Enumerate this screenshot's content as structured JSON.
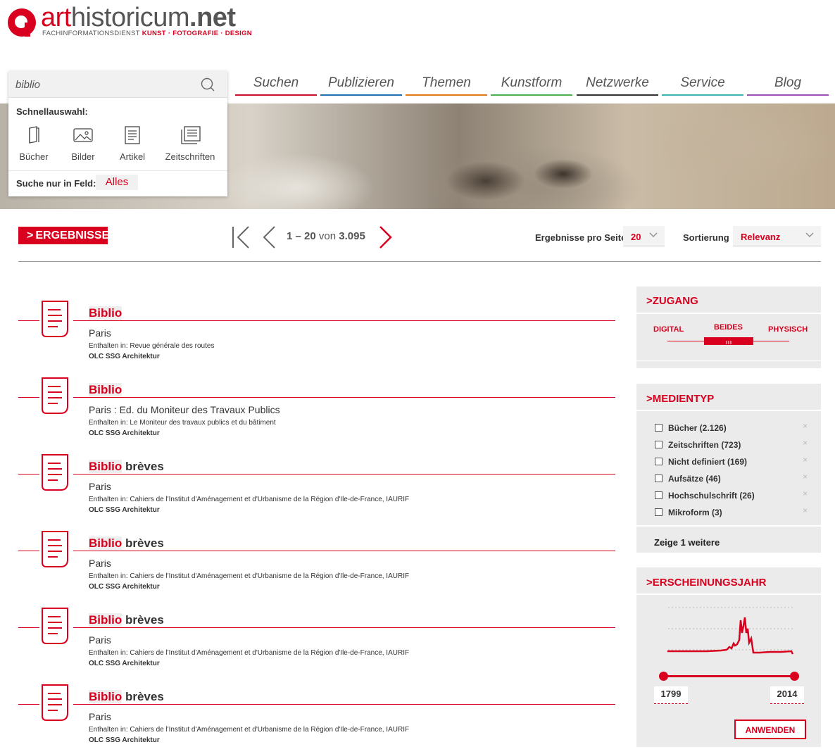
{
  "brand": {
    "name_prefix": "art",
    "name_main": "historicum",
    "name_suffix": ".net",
    "tagline_plain": "FACHINFORMATIONSDIENST",
    "tagline_accent": "KUNST · FOTOGRAFIE · DESIGN",
    "accent_color": "#d8001e"
  },
  "search": {
    "query": "biblio",
    "quick_label": "Schnellauswahl:",
    "quick_items": [
      "Bücher",
      "Bilder",
      "Artikel",
      "Zeitschriften"
    ],
    "field_label": "Suche nur in Feld:",
    "field_value": "Alles"
  },
  "nav": {
    "items": [
      {
        "label": "Suchen",
        "color": "#c8102e"
      },
      {
        "label": "Publizieren",
        "color": "#1f6fb2"
      },
      {
        "label": "Themen",
        "color": "#e07b1a"
      },
      {
        "label": "Kunstform",
        "color": "#4caf50"
      },
      {
        "label": "Netzwerke",
        "color": "#333333"
      },
      {
        "label": "Service",
        "color": "#3fb3b0"
      },
      {
        "label": "Blog",
        "color": "#9c4fb5"
      }
    ]
  },
  "toolbar": {
    "results_label": "ERGEBNISSE",
    "range": "1 – 20",
    "of_word": "von",
    "total": "3.095",
    "per_page_label": "Ergebnisse pro Seite",
    "per_page_value": "20",
    "sort_label": "Sortierung",
    "sort_value": "Relevanz"
  },
  "results": [
    {
      "title_hl": "Biblio",
      "title_rest": "",
      "subtitle": "Paris",
      "contained_in": "Enthalten in: Revue générale des routes",
      "source": "OLC SSG Architektur"
    },
    {
      "title_hl": "Biblio",
      "title_rest": "",
      "subtitle": "Paris : Ed. du Moniteur des Travaux Publics",
      "contained_in": "Enthalten in: Le Moniteur des travaux publics et du bâtiment",
      "source": "OLC SSG Architektur"
    },
    {
      "title_hl": "Biblio",
      "title_rest": "brèves",
      "subtitle": "Paris",
      "contained_in": "Enthalten in: Cahiers de l'Institut d'Aménagement et d'Urbanisme de la Région d'Ile-de-France, IAURIF",
      "source": "OLC SSG Architektur"
    },
    {
      "title_hl": "Biblio",
      "title_rest": "brèves",
      "subtitle": "Paris",
      "contained_in": "Enthalten in: Cahiers de l'Institut d'Aménagement et d'Urbanisme de la Région d'Ile-de-France, IAURIF",
      "source": "OLC SSG Architektur"
    },
    {
      "title_hl": "Biblio",
      "title_rest": "brèves",
      "subtitle": "Paris",
      "contained_in": "Enthalten in: Cahiers de l'Institut d'Aménagement et d'Urbanisme de la Région d'Ile-de-France, IAURIF",
      "source": "OLC SSG Architektur"
    },
    {
      "title_hl": "Biblio",
      "title_rest": "brèves",
      "subtitle": "Paris",
      "contained_in": "Enthalten in: Cahiers de l'Institut d'Aménagement et d'Urbanisme de la Région d'Ile-de-France, IAURIF",
      "source": "OLC SSG Architektur"
    }
  ],
  "facets": {
    "zugang": {
      "title": "ZUGANG",
      "options": [
        "DIGITAL",
        "BEIDES",
        "PHYSISCH"
      ],
      "selected": "BEIDES"
    },
    "medientyp": {
      "title": "MEDIENTYP",
      "items": [
        "Bücher (2.126)",
        "Zeitschriften (723)",
        "Nicht definiert (169)",
        "Aufsätze (46)",
        "Hochschulschrift (26)",
        "Mikroform (3)"
      ],
      "more": "Zeige 1 weitere"
    },
    "jahr": {
      "title": "ERSCHEINUNGSJAHR",
      "from": "1799",
      "to": "2014",
      "apply": "ANWENDEN"
    }
  }
}
